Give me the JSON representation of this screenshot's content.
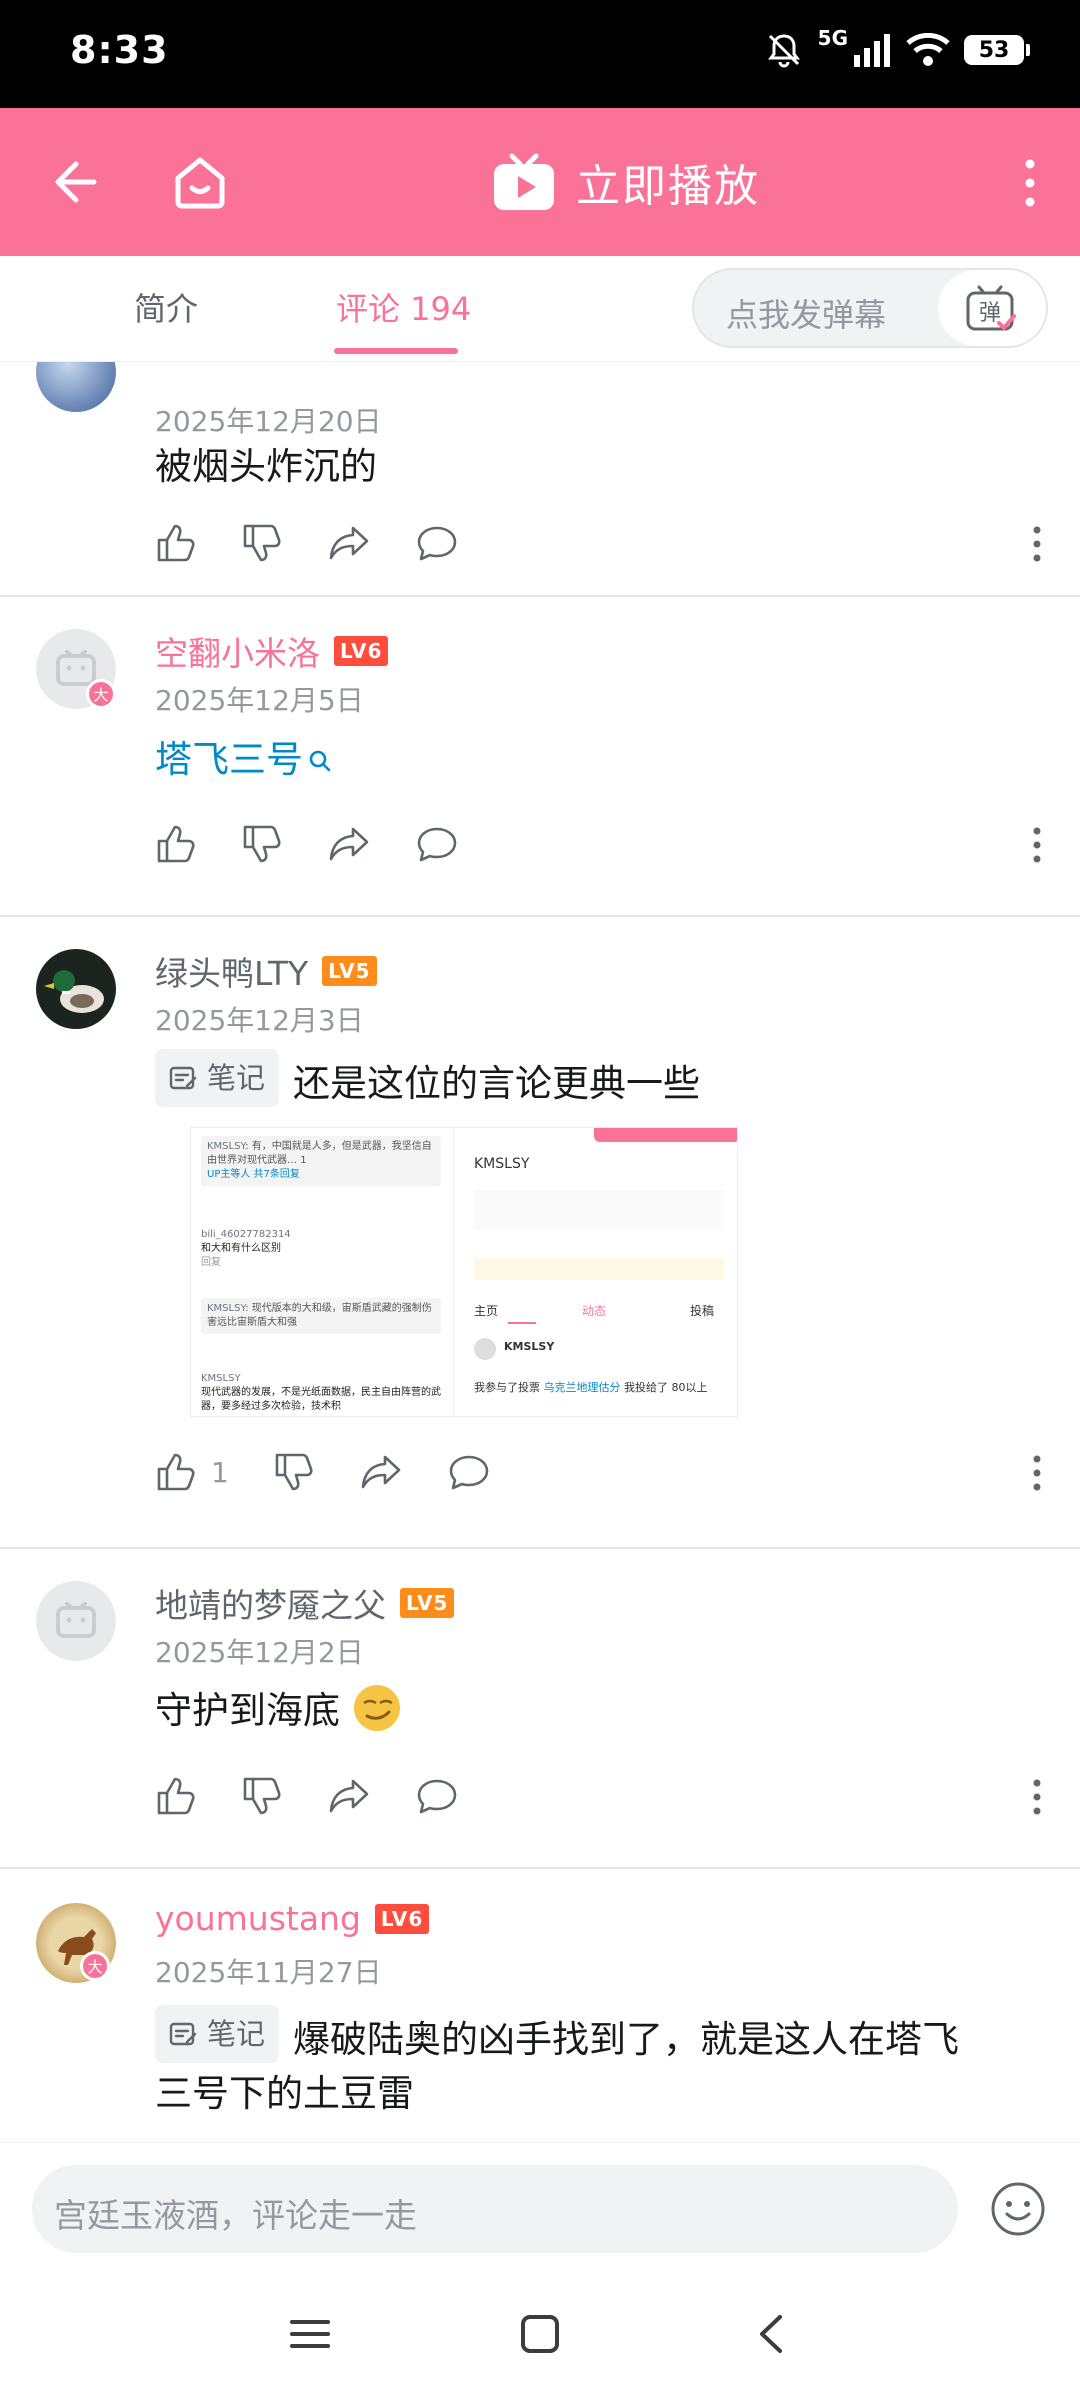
{
  "status_bar": {
    "time": "8:33",
    "network": "5G",
    "battery": "53"
  },
  "header": {
    "play_label": "立即播放"
  },
  "tabs": {
    "intro": "简介",
    "comments": "评论 194",
    "danmaku_placeholder": "点我发弹幕",
    "danmaku_button": "弹"
  },
  "comments": [
    {
      "date": "2025年12月20日",
      "text": "被烟头炸沉的"
    },
    {
      "username": "空翻小米洛",
      "level": "LV6",
      "badge": "大",
      "date": "2025年12月5日",
      "text": "塔飞三号"
    },
    {
      "username": "绿头鸭LTY",
      "level": "LV5",
      "date": "2025年12月3日",
      "note_tag": "笔记",
      "text": "还是这位的言论更典一些",
      "likes": "1",
      "image": {
        "left": {
          "rows": [
            {
              "name": "KMSLSY",
              "text": "有，中国就是人多，但是武器，我坚信自由世界对现代武器…",
              "like": "1"
            },
            {
              "reply": "UP主等人 共7条回复"
            },
            {
              "name": "bili_46027782314",
              "text": "和大和有什么区别",
              "meta": "回复"
            },
            {
              "name": "KMSLSY",
              "text": "现代版本的大和级，宙斯盾武藏的强制伤害远比宙斯盾大和强"
            },
            {
              "name": "KMSLSY",
              "text": "现代武器的发展，不是光纸面数据，民主自由阵营的武器，要多经过多次检验，技术积"
            }
          ]
        },
        "right": {
          "name": "KMSLSY",
          "tabs": [
            "主页",
            "动态",
            "投稿"
          ],
          "post_name": "KMSLSY",
          "post_text": "我参与了投票",
          "post_link": "乌克兰地理估分",
          "post_text2": "我投给了 80以上"
        }
      }
    },
    {
      "username": "地靖的梦魇之父",
      "level": "LV5",
      "date": "2025年12月2日",
      "text": "守护到海底"
    },
    {
      "username": "youmustang",
      "level": "LV6",
      "badge": "大",
      "date": "2025年11月27日",
      "note_tag": "笔记",
      "text_line1": "爆破陆奥的凶手找到了，就是这人在塔飞",
      "text_line2": "三号下的土豆雷"
    }
  ],
  "input": {
    "placeholder": "宫廷玉液酒，评论走一走"
  },
  "colors": {
    "brand_pink": "#fb7299",
    "link_blue": "#008ac5",
    "lv6": "#ff4d3d",
    "lv5": "#ff8c1a"
  }
}
